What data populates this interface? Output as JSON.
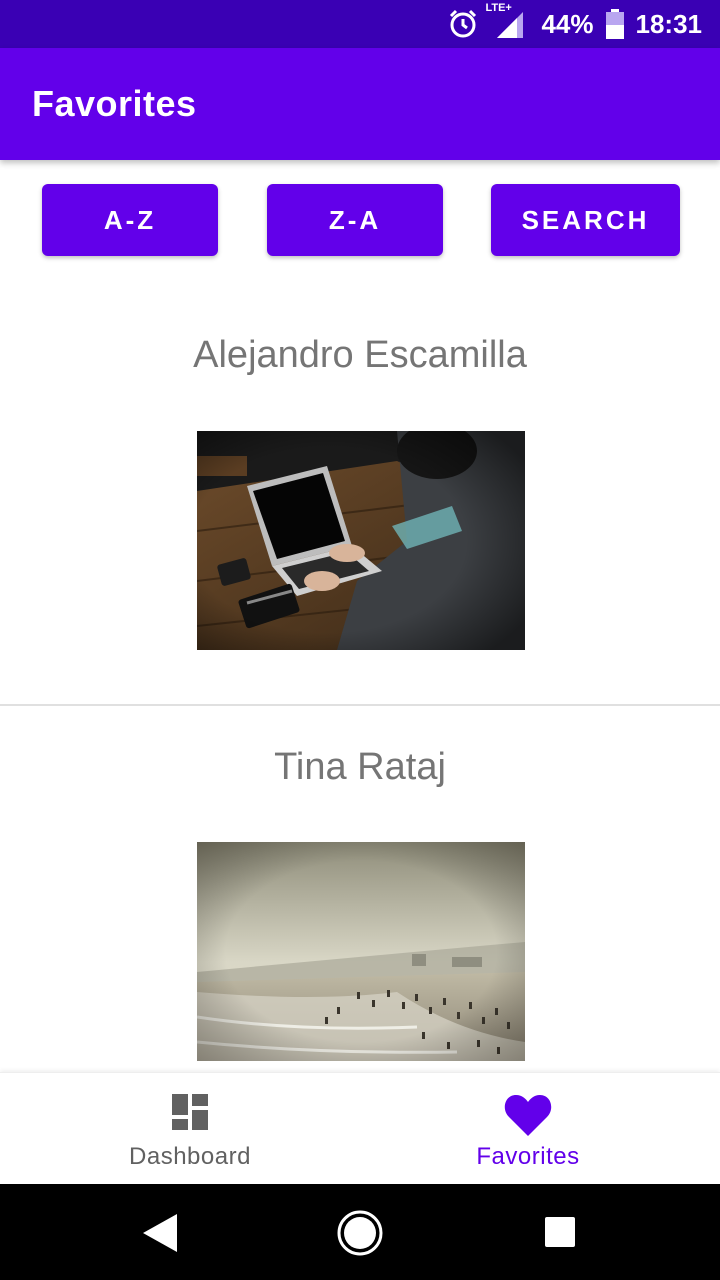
{
  "status_bar": {
    "alarm_icon": "alarm-icon",
    "signal_icon": "signal-lte-icon",
    "network_label": "LTE+",
    "battery_percent": "44%",
    "battery_icon": "battery-icon",
    "time": "18:31"
  },
  "app_bar": {
    "title": "Favorites"
  },
  "sort_buttons": {
    "az_label": "A-Z",
    "za_label": "Z-A",
    "search_label": "SEARCH"
  },
  "favorites": [
    {
      "author": "Alejandro Escamilla",
      "photo": "laptop-desk-photo"
    },
    {
      "author": "Tina Rataj",
      "photo": "beach-photo"
    }
  ],
  "bottom_nav": {
    "items": [
      {
        "label": "Dashboard",
        "icon": "dashboard-icon",
        "active": false
      },
      {
        "label": "Favorites",
        "icon": "heart-icon",
        "active": true
      }
    ]
  },
  "system_nav": {
    "back_icon": "back-icon",
    "home_icon": "home-icon",
    "recents_icon": "recents-icon"
  },
  "colors": {
    "primary": "#6200ea",
    "status_bar": "#3a00b4",
    "inactive_nav": "#616161",
    "name_text": "#757575"
  }
}
